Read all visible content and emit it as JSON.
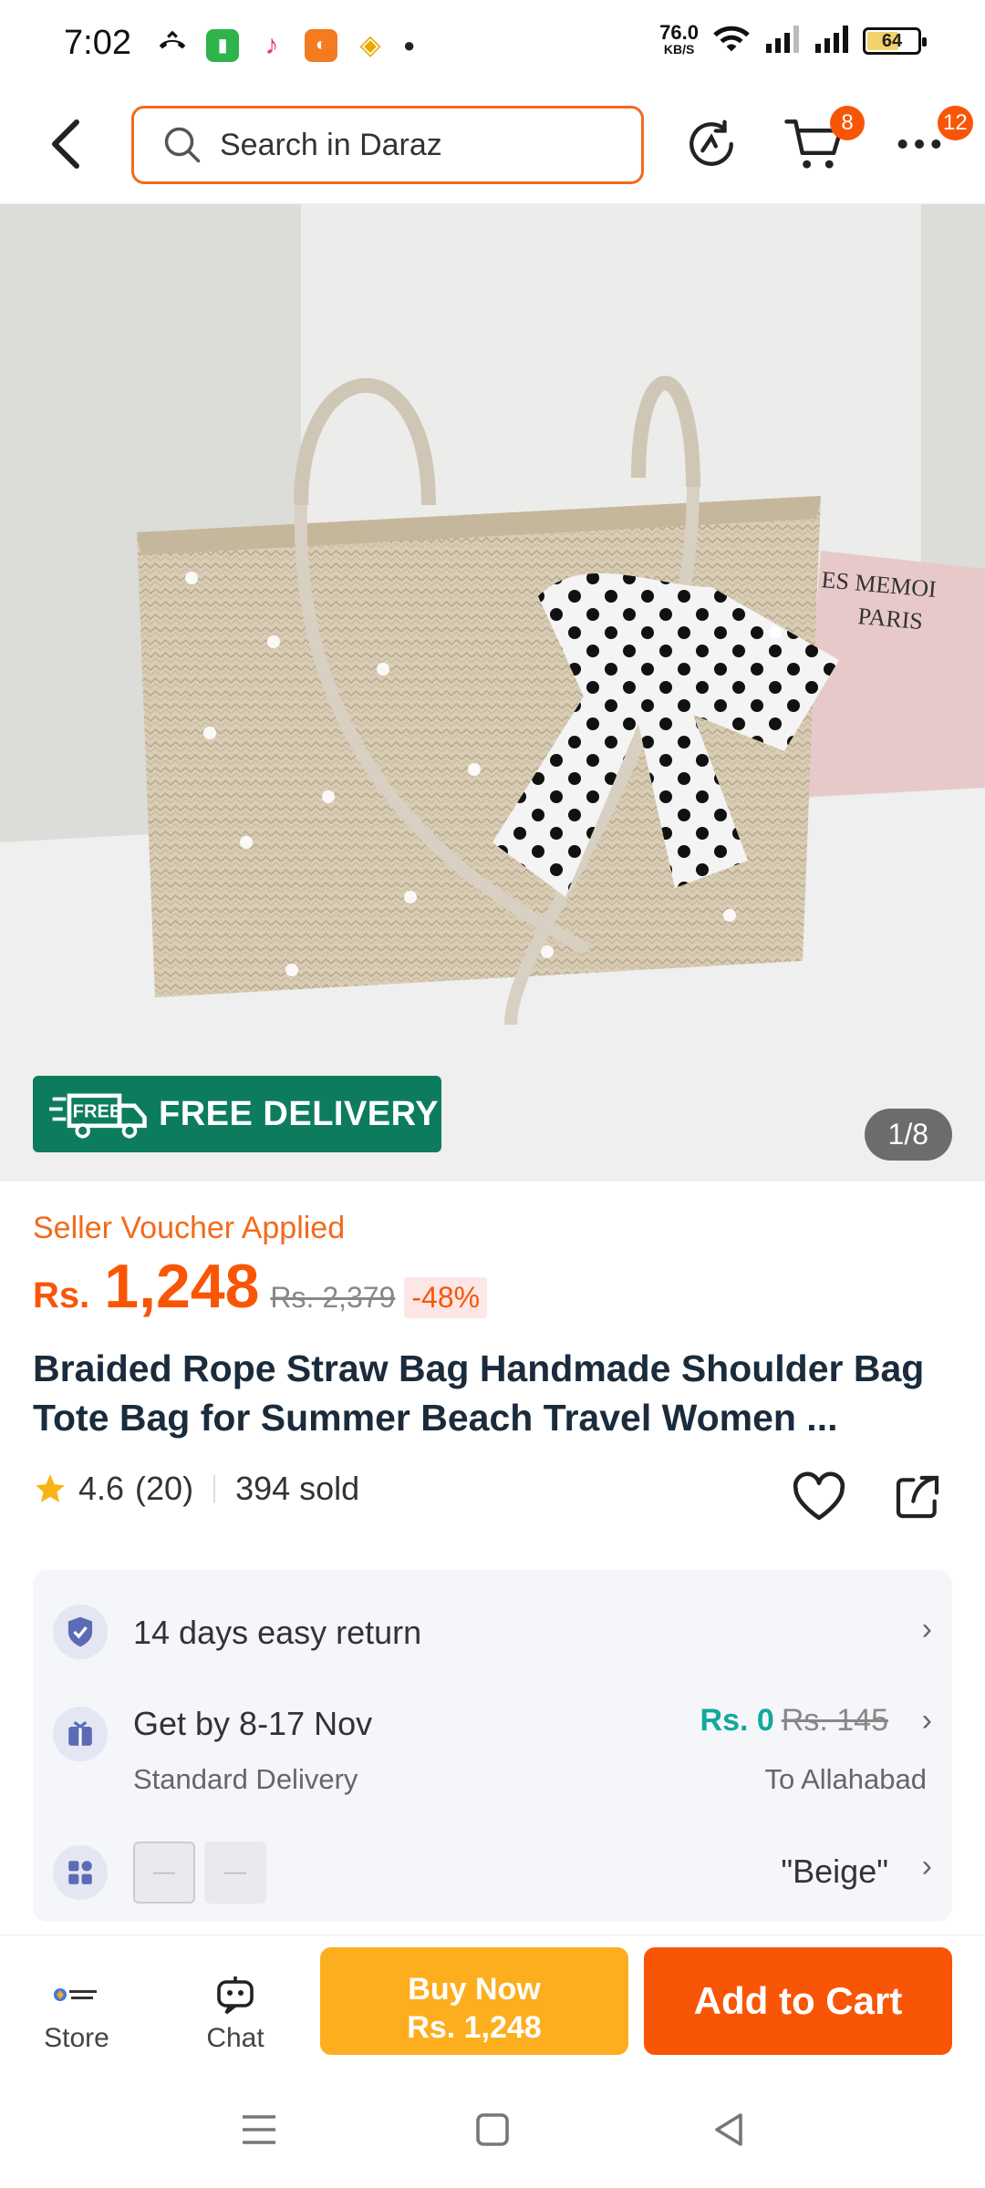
{
  "status_bar": {
    "time": "7:02",
    "net_speed_value": "76.0",
    "net_speed_unit": "KB/S",
    "battery": "64"
  },
  "header": {
    "search_placeholder": "Search in Daraz",
    "cart_badge": "8",
    "more_badge": "12"
  },
  "gallery": {
    "free_delivery": "FREE DELIVERY",
    "free_delivery_icon_text": "FREE",
    "counter": "1/8"
  },
  "product": {
    "voucher": "Seller Voucher Applied",
    "currency": "Rs.",
    "price": "1,248",
    "original_price": "Rs. 2,379",
    "discount": "-48%",
    "title": "Braided Rope Straw Bag Handmade Shoulder Bag Tote Bag for Summer Beach Travel Women ...",
    "rating": "4.6",
    "rating_count": "(20)",
    "sold": "394 sold"
  },
  "services": {
    "return": "14 days easy return",
    "delivery": "Get by 8-17 Nov",
    "delivery_type": "Standard Delivery",
    "shipping_fee": "Rs. 0",
    "shipping_fee_original": "Rs. 145",
    "destination": "To Allahabad",
    "variant": "\"Beige\""
  },
  "bottom_bar": {
    "store": "Store",
    "chat": "Chat",
    "buy_now_line1": "Buy Now",
    "buy_now_line2": "Rs. 1,248",
    "add_to_cart": "Add to Cart"
  },
  "colors": {
    "accent": "#f85606",
    "buy_now": "#fdae1f",
    "free_delivery": "#0d7c5e",
    "free_shipping": "#12a89d"
  }
}
